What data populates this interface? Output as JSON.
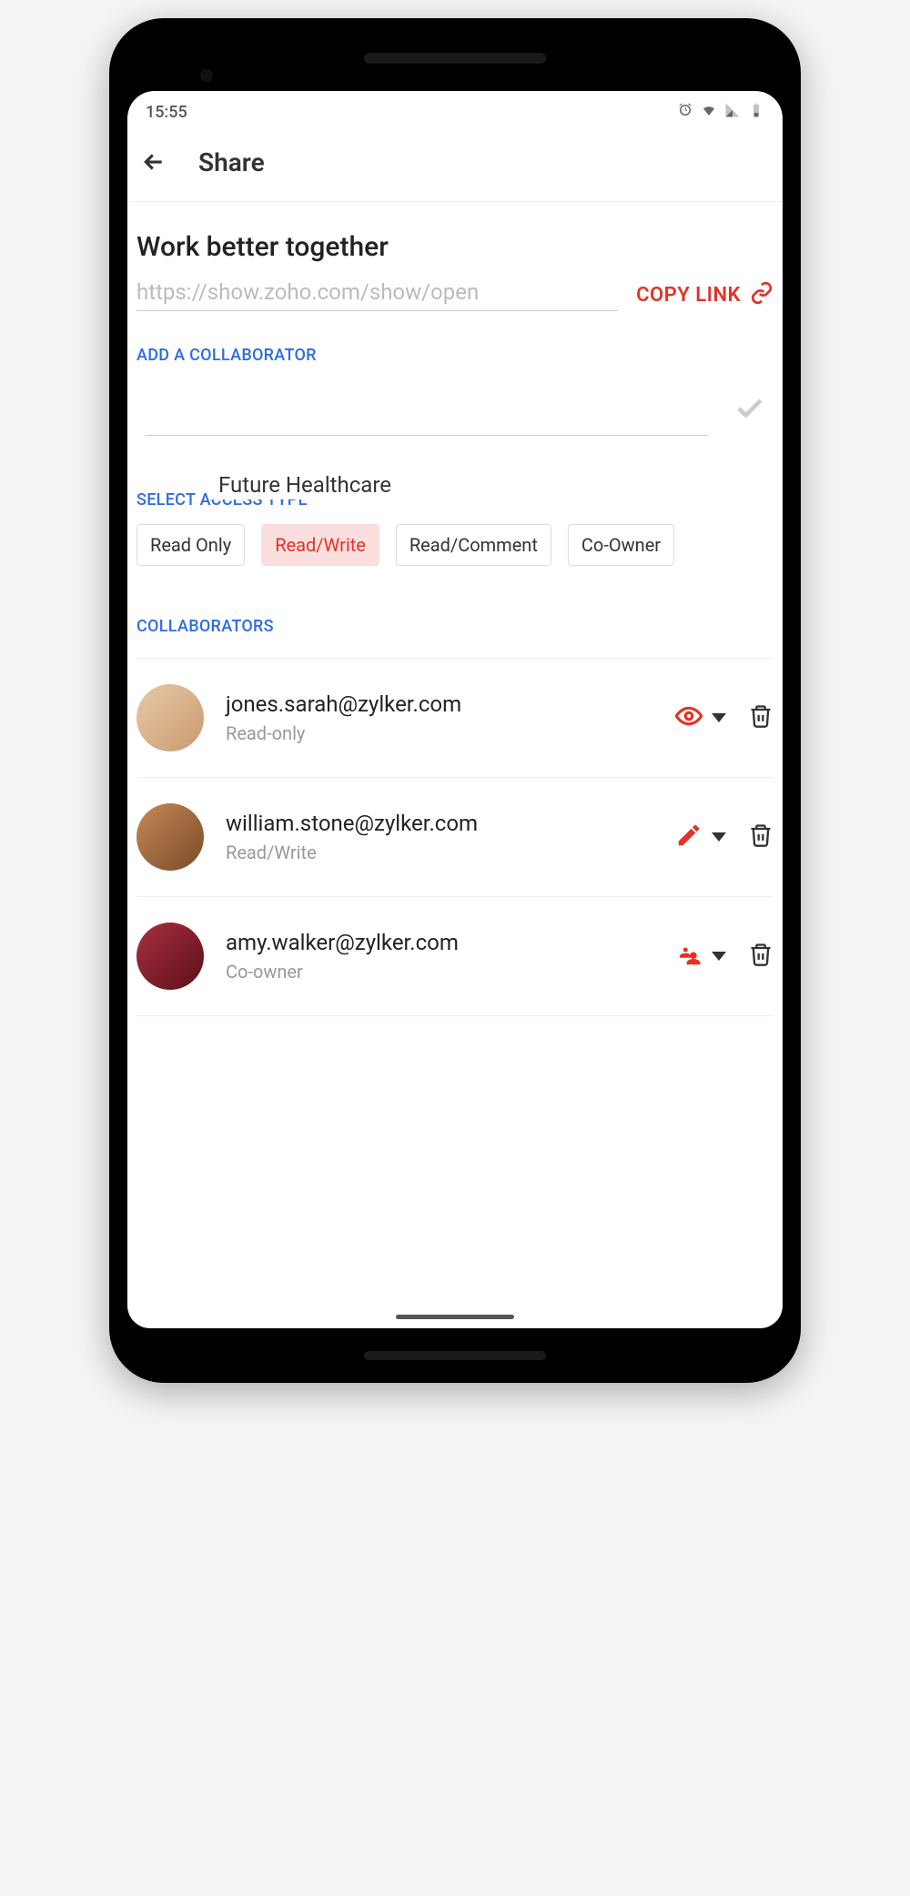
{
  "status": {
    "time": "15:55"
  },
  "appBar": {
    "title": "Share"
  },
  "heading": "Work better together",
  "share_link": "https://show.zoho.com/show/open",
  "copy_link_label": "COPY LINK",
  "tooltip_text": "Future Healthcare",
  "labels": {
    "add_collaborator": "ADD A COLLABORATOR",
    "select_access_type": "SELECT ACCESS TYPE",
    "collaborators": "COLLABORATORS"
  },
  "access_types": [
    {
      "label": "Read Only",
      "active": false
    },
    {
      "label": "Read/Write",
      "active": true
    },
    {
      "label": "Read/Comment",
      "active": false
    },
    {
      "label": "Co-Owner",
      "active": false
    }
  ],
  "collaborators": [
    {
      "email": "jones.sarah@zylker.com",
      "role": "Read-only",
      "perm_icon": "eye",
      "avatar_bg": "#d9b58e"
    },
    {
      "email": "william.stone@zylker.com",
      "role": "Read/Write",
      "perm_icon": "pencil",
      "avatar_bg": "#a87048"
    },
    {
      "email": "amy.walker@zylker.com",
      "role": "Co-owner",
      "perm_icon": "people",
      "avatar_bg": "#7a1820"
    }
  ]
}
